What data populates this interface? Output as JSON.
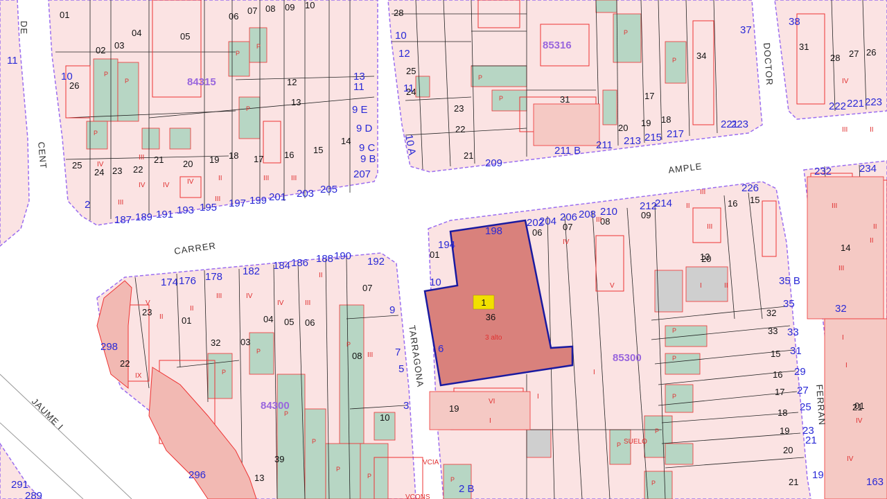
{
  "map": {
    "streets": [
      "DE",
      "CENT",
      "CARRER",
      "AMPLE",
      "TARRAGONA",
      "DOCTOR",
      "FERRAN",
      "JAUME I"
    ],
    "manzanas": [
      "84315",
      "85316",
      "85300",
      "84300"
    ],
    "highlighted_parcel": {
      "label": "1",
      "number": "36"
    },
    "building_numbers": [
      "11",
      "10",
      "9 E",
      "9 D",
      "9 C",
      "9 B",
      "13",
      "11",
      "2",
      "187",
      "189",
      "191",
      "193",
      "195",
      "197",
      "199",
      "201",
      "203",
      "205",
      "207",
      "10",
      "12",
      "11",
      "10 A",
      "209",
      "211 B",
      "211",
      "213",
      "215",
      "217",
      "221",
      "223",
      "37",
      "38",
      "222",
      "221",
      "223",
      "194",
      "198",
      "202",
      "204",
      "206",
      "208",
      "210",
      "212",
      "214",
      "226",
      "35 B",
      "35",
      "33",
      "31",
      "29",
      "27",
      "25",
      "23",
      "21",
      "19",
      "10",
      "6",
      "2 B",
      "174",
      "176",
      "178",
      "182",
      "184",
      "186",
      "188",
      "190",
      "192",
      "9",
      "7",
      "5",
      "3",
      "298",
      "296",
      "291",
      "289",
      "232",
      "234",
      "32",
      "163"
    ],
    "parcel_numbers": [
      "01",
      "02",
      "03",
      "04",
      "05",
      "06",
      "07",
      "08",
      "09",
      "10",
      "26",
      "25",
      "24",
      "23",
      "22",
      "21",
      "20",
      "19",
      "18",
      "17",
      "16",
      "15",
      "14",
      "13",
      "12",
      "28",
      "23",
      "22",
      "21",
      "31",
      "34",
      "31",
      "28",
      "27",
      "26",
      "25",
      "24",
      "20",
      "19",
      "18",
      "17",
      "16",
      "15",
      "01",
      "07",
      "08",
      "09",
      "06",
      "13",
      "14",
      "01",
      "32",
      "33",
      "15",
      "16",
      "17",
      "18",
      "19",
      "20",
      "21",
      "22",
      "23",
      "01",
      "32",
      "03",
      "04",
      "05",
      "06",
      "07",
      "08",
      "10",
      "39",
      "13",
      "19",
      "20",
      "21",
      "36",
      "33"
    ]
  },
  "colors": {
    "parcel_fill": "#fbe3e3",
    "parcel_line": "#ee3333",
    "patio_fill": "#b7d6c4",
    "block_outline": "#9a6df0",
    "highlight_fill": "#d9817c",
    "highlight_stroke": "#1a1aa0",
    "label_fill": "#f2e000",
    "street_fill": "#ffffff",
    "bnum_color": "#2929d6",
    "manzana_color": "#9966dd"
  }
}
